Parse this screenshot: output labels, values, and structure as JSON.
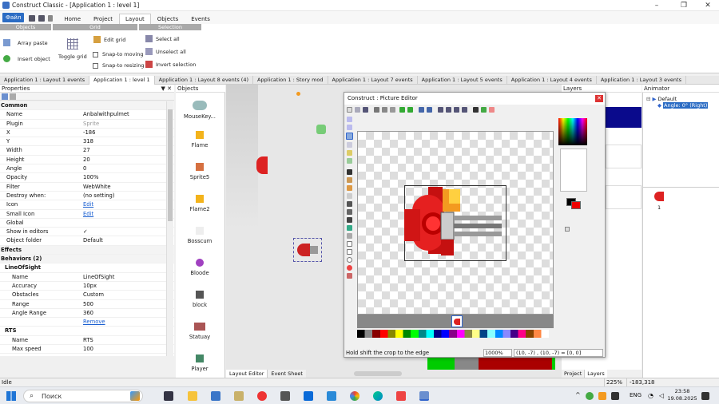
{
  "window": {
    "title": "Construct Classic - [Application 1 : level 1]",
    "minimize": "–",
    "restore": "❐",
    "close": "✕"
  },
  "menu": {
    "file": "Файл",
    "tabs": [
      "Home",
      "Project",
      "Layout",
      "Objects",
      "Events"
    ]
  },
  "ribbon": {
    "groups": {
      "objects": "Objects",
      "grid": "Grid",
      "selection": "Selection"
    },
    "array_paste": "Array paste",
    "insert_object": "Insert object",
    "toggle_grid": "Toggle grid",
    "edit_grid": "Edit grid",
    "snap_moving": "Snap-to moving",
    "snap_resizing": "Snap-to resizing",
    "select_all": "Select all",
    "unselect_all": "Unselect all",
    "invert_selection": "Invert selection"
  },
  "doc_tabs": [
    "Application 1 : Layout 1 events",
    "Application 1 : level 1",
    "Application 1 : Layout 8 events (4)",
    "Application 1 : Story mod",
    "Application 1 : Layout 7 events",
    "Application 1 : Layout 5 events",
    "Application 1 : Layout 4 events",
    "Application 1 : Layout 3 events"
  ],
  "properties": {
    "title": "Properties",
    "pin": "▼ ✕",
    "rows": [
      {
        "k": "Common",
        "cat": true
      },
      {
        "k": "Name",
        "v": "Anbalwithpulmet"
      },
      {
        "k": "Plugin",
        "v": "Sprite",
        "grey": true
      },
      {
        "k": "X",
        "v": "-186"
      },
      {
        "k": "Y",
        "v": "318"
      },
      {
        "k": "Width",
        "v": "27"
      },
      {
        "k": "Height",
        "v": "20"
      },
      {
        "k": "Angle",
        "v": "0"
      },
      {
        "k": "Opacity",
        "v": "100%"
      },
      {
        "k": "Filter",
        "v": "WebWhite"
      },
      {
        "k": "Destroy when:",
        "v": "(no setting)"
      },
      {
        "k": "Icon",
        "v": "Edit",
        "link": true
      },
      {
        "k": "Small Icon",
        "v": "Edit",
        "link": true
      },
      {
        "k": "Global",
        "v": ""
      },
      {
        "k": "Show in editors",
        "v": "✓"
      },
      {
        "k": "Object folder",
        "v": "Default"
      },
      {
        "k": "Effects",
        "cat": true
      },
      {
        "k": "Behaviors (2)",
        "cat": true
      },
      {
        "k": "LineOfSight",
        "subcat": true
      },
      {
        "k": "Name",
        "v": "LineOfSight",
        "sub": true
      },
      {
        "k": "Accuracy",
        "v": "10px",
        "sub": true
      },
      {
        "k": "Obstacles",
        "v": "Custom",
        "sub": true
      },
      {
        "k": "Range",
        "v": "500",
        "sub": true
      },
      {
        "k": "Angle Range",
        "v": "360",
        "sub": true
      },
      {
        "k": "",
        "v": "Remove",
        "link": true,
        "sub": true
      },
      {
        "k": "RTS",
        "subcat": true
      },
      {
        "k": "Name",
        "v": "RTS",
        "sub": true
      },
      {
        "k": "Max speed",
        "v": "100",
        "sub": true
      }
    ]
  },
  "objects": {
    "title": "Objects",
    "items": [
      "MouseKey...",
      "Flame",
      "Sprite5",
      "Flame2",
      "Bosscum",
      "Bloode",
      "block",
      "Statuay",
      "Player"
    ]
  },
  "layout_tabs": [
    "Layout Editor",
    "Event Sheet"
  ],
  "picture_editor": {
    "title": "Construct : Picture Editor",
    "close": "✕",
    "status": "Hold shift the crop to the edge",
    "zoom": "1000%",
    "coords": "(10, -7) , (10, -7) = [0, 0]"
  },
  "layers": {
    "title": "Layers",
    "tabs": [
      "Project",
      "Layers"
    ]
  },
  "animator": {
    "title": "Animator",
    "tree_root": "Default",
    "tree_child": "Angle: 0° (Right)",
    "frame": "1"
  },
  "status": {
    "left": "Idle",
    "zoom": "225%",
    "coords": "-183,318"
  },
  "taskbar": {
    "search": "Поиск",
    "lang": "ENG",
    "time": "23:58",
    "date": "19.08.2025"
  }
}
